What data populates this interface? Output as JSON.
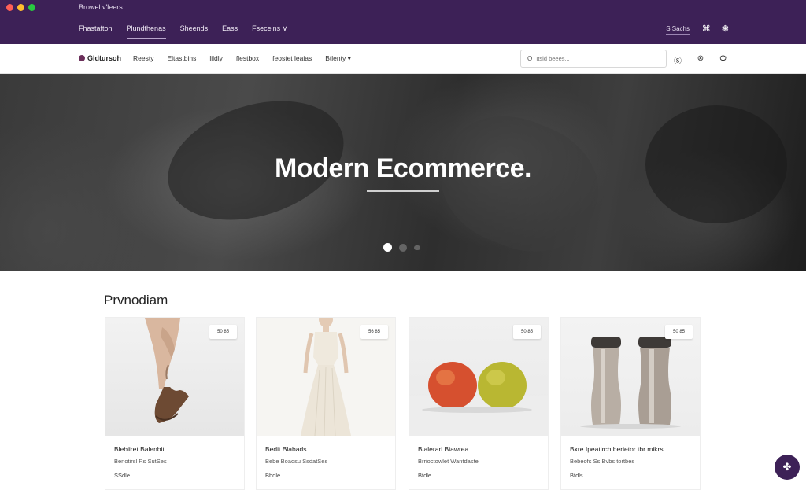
{
  "window": {
    "title": "Browel v'leers"
  },
  "top_nav": {
    "items": [
      {
        "label": "Fhastafton",
        "active": false
      },
      {
        "label": "Plundthenas",
        "active": true
      },
      {
        "label": "Sheends",
        "active": false
      },
      {
        "label": "Eass",
        "active": false
      },
      {
        "label": "Fseceins",
        "active": false
      }
    ],
    "dropdown_glyph": "∨",
    "right_link": "S Sachs",
    "icons": [
      "cart-icon",
      "user-icon"
    ]
  },
  "nav2": {
    "logo": "Gldtursoh",
    "links": [
      "Reesty",
      "Eltastbins",
      "lildly",
      "flestbox",
      "feostet leaias",
      "Btlenty"
    ],
    "dropdown_glyph": "▾",
    "search_placeholder": "Itsid beees...",
    "icons": [
      "help-icon",
      "notifications-icon",
      "account-icon"
    ]
  },
  "hero": {
    "title": "Modern Ecommerce."
  },
  "products_section": {
    "title": "Prvnodiam",
    "cards": [
      {
        "badge": "50 85",
        "name": "Blebliret Balenbit",
        "desc": "Benotirsl Rs SutSes",
        "price": "SSdle",
        "image": "shoe"
      },
      {
        "badge": "56 85",
        "name": "Bedit Blabads",
        "desc": "Bebe Boadsu SsdatSes",
        "price": "Bbdle",
        "image": "dress"
      },
      {
        "badge": "50 85",
        "name": "Bialerarl Biawrea",
        "desc": "Brrioctowlet Wantdaste",
        "price": "Btdle",
        "image": "apple"
      },
      {
        "badge": "50 85",
        "name": "Bxre Ipeatirch berietor tbr mikrs",
        "desc": "Bebeofs Ss Bvbs tortbes",
        "price": "Btdls",
        "image": "bottle"
      }
    ]
  },
  "fab": {
    "icon": "grid-icon"
  }
}
